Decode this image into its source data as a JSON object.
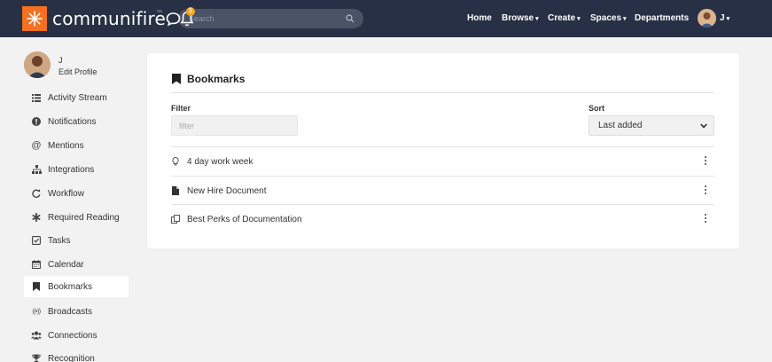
{
  "brand": {
    "name": "communifire",
    "tm": "™",
    "notification_count": "1"
  },
  "search": {
    "placeholder": "Search"
  },
  "nav": [
    {
      "label": "Home",
      "caret": ""
    },
    {
      "label": "Browse",
      "caret": "▾"
    },
    {
      "label": "Create",
      "caret": "▾"
    },
    {
      "label": "Spaces",
      "caret": "▾"
    },
    {
      "label": "Departments",
      "caret": ""
    }
  ],
  "user": {
    "initial": "J",
    "caret": "▾"
  },
  "profile": {
    "name": "J",
    "edit_label": "Edit Profile"
  },
  "sidebar": {
    "items": [
      {
        "label": "Activity Stream",
        "icon": "list-icon"
      },
      {
        "label": "Notifications",
        "icon": "info-icon"
      },
      {
        "label": "Mentions",
        "icon": "at-icon"
      },
      {
        "label": "Integrations",
        "icon": "sitemap-icon"
      },
      {
        "label": "Workflow",
        "icon": "refresh-icon"
      },
      {
        "label": "Required Reading",
        "icon": "asterisk-icon"
      },
      {
        "label": "Tasks",
        "icon": "checkbox-icon"
      },
      {
        "label": "Calendar",
        "icon": "calendar-icon"
      },
      {
        "label": "Bookmarks",
        "icon": "bookmark-icon",
        "active": true
      },
      {
        "label": "Broadcasts",
        "icon": "broadcast-icon"
      },
      {
        "label": "Connections",
        "icon": "users-icon"
      },
      {
        "label": "Recognition",
        "icon": "trophy-icon"
      }
    ]
  },
  "main": {
    "title": "Bookmarks",
    "filter": {
      "label": "Filter",
      "placeholder": "filter",
      "value": ""
    },
    "sort": {
      "label": "Sort",
      "selected": "Last added"
    },
    "bookmarks": [
      {
        "label": "4 day work week",
        "icon": "lightbulb-icon"
      },
      {
        "label": "New Hire Document",
        "icon": "document-icon"
      },
      {
        "label": "Best Perks of Documentation",
        "icon": "copy-icon"
      }
    ]
  },
  "colors": {
    "topbar": "#273044",
    "brand_orange": "#f37021",
    "badge": "#f5a623"
  }
}
